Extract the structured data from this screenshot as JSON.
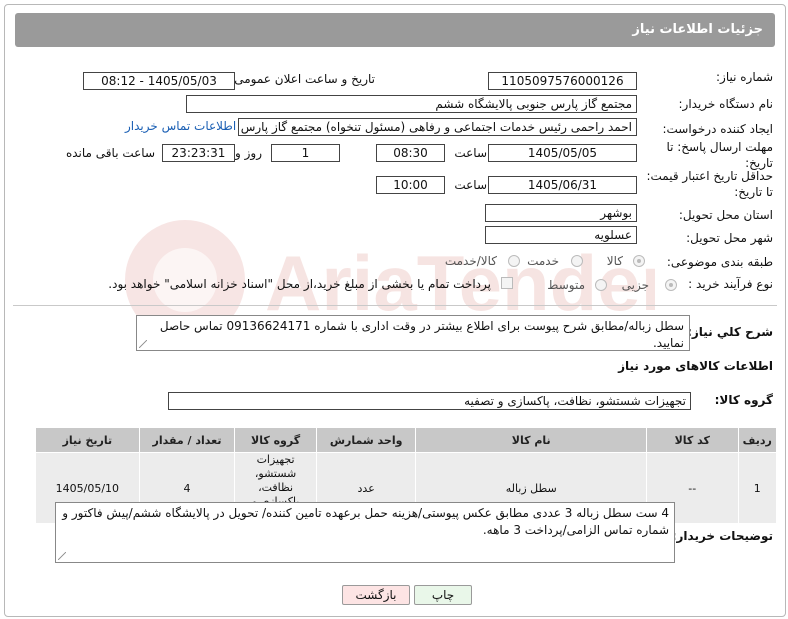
{
  "header": {
    "title": "جزئیات اطلاعات نیاز"
  },
  "fields": {
    "need_number_label": "شماره نیاز:",
    "need_number": "1105097576000126",
    "announce_label": "تاریخ و ساعت اعلان عمومی:",
    "announce_value": "1405/05/03 - 08:12",
    "buyer_org_label": "نام دستگاه خریدار:",
    "buyer_org": "مجتمع گاز پارس جنوبی  پالایشگاه ششم",
    "creator_label": "ایجاد کننده درخواست:",
    "creator": "احمد راحمی رئیس خدمات اجتماعی و رفاهی (مسئول تنخواه) مجتمع گاز پارس",
    "buyer_contact_link": "اطلاعات تماس خریدار",
    "reply_deadline_label": "مهلت ارسال پاسخ: تا تاریخ:",
    "reply_date": "1405/05/05",
    "time_label": "ساعت",
    "reply_time": "08:30",
    "day_count": "1",
    "day_and_label": "روز و",
    "remaining_time": "23:23:31",
    "remaining_label": "ساعت باقی مانده",
    "price_deadline_label": "حداقل تاریخ اعتبار قیمت: تا تاریخ:",
    "price_date": "1405/06/31",
    "price_time": "10:00",
    "province_label": "استان محل تحویل:",
    "province": "بوشهر",
    "city_label": "شهر محل تحویل:",
    "city": "عسلویه",
    "category_label": "طبقه بندی موضوعی:",
    "category_options": [
      "کالا",
      "خدمت",
      "کالا/خدمت"
    ],
    "process_label": "نوع فرآیند خرید :",
    "process_options": [
      "جزیی",
      "متوسط"
    ],
    "payment_note": "پرداخت تمام یا بخشی از مبلغ خرید،از محل \"اسناد خزانه اسلامی\" خواهد بود."
  },
  "summary": {
    "label": "شرح کلي نياز:",
    "text": "سطل زباله/مطابق شرح پیوست برای اطلاع بیشتر در وقت اداری با شماره 09136624171 تماس حاصل نمایید."
  },
  "goods": {
    "section_title": "اطلاعات کالاهای مورد نیاز",
    "group_label": "گروه کالا:",
    "group_value": "تجهیزات شستشو، نظافت، پاکسازی و تصفیه",
    "columns": [
      "ردیف",
      "کد کالا",
      "نام کالا",
      "واحد شمارش",
      "گروه کالا",
      "تعداد / مقدار",
      "تاریخ نیاز"
    ],
    "rows": [
      {
        "row": "1",
        "code": "--",
        "name": "سطل زباله",
        "unit": "عدد",
        "group": "تجهیزات شستشو، نظافت، پاکسازی و تصفیه",
        "qty": "4",
        "date": "1405/05/10"
      }
    ]
  },
  "buyer_notes": {
    "label": "توضیحات خریدار:",
    "text": "4 ست سطل زباله 3 عددی مطابق عکس پیوستی/هزینه حمل برعهده تامین کننده/ تحویل در پالایشگاه ششم/پیش فاکتور و شماره تماس الزامی/پرداخت 3 ماهه."
  },
  "buttons": {
    "print": "چاپ",
    "back": "بازگشت"
  },
  "watermark": {
    "text": "AriaTender.net"
  }
}
